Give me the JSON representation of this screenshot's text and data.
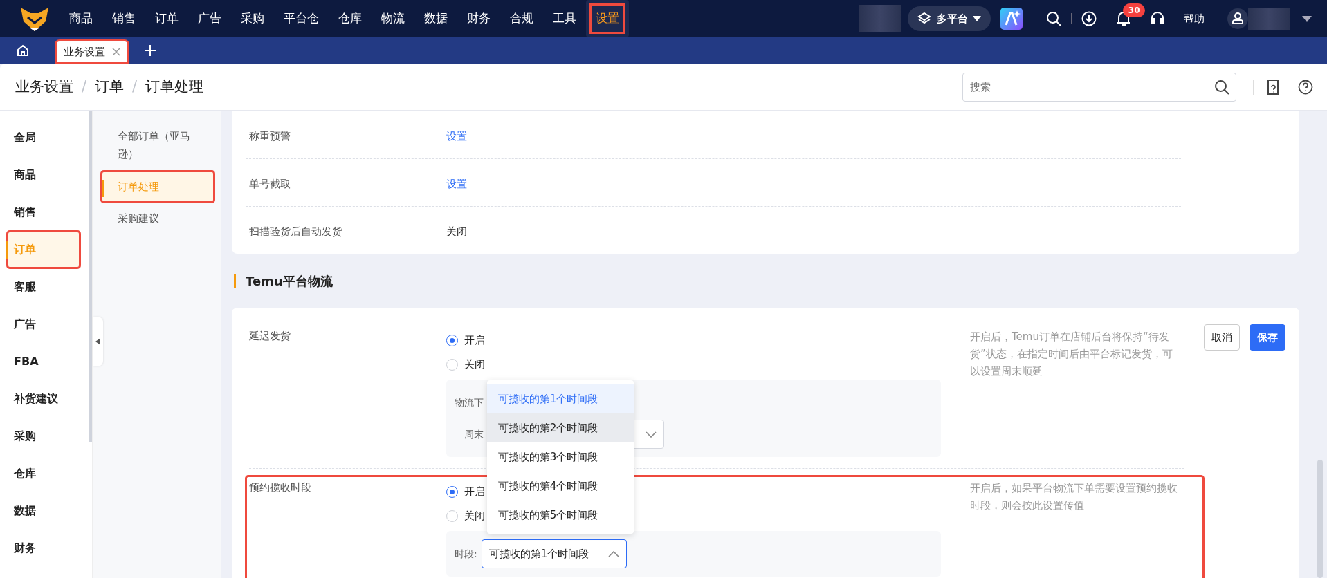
{
  "top_nav": {
    "items": [
      {
        "label": "商品",
        "selected": false,
        "highlighted": false
      },
      {
        "label": "销售",
        "selected": false,
        "highlighted": false
      },
      {
        "label": "订单",
        "selected": false,
        "highlighted": false
      },
      {
        "label": "广告",
        "selected": false,
        "highlighted": false
      },
      {
        "label": "采购",
        "selected": false,
        "highlighted": false
      },
      {
        "label": "平台仓",
        "selected": false,
        "highlighted": false
      },
      {
        "label": "仓库",
        "selected": false,
        "highlighted": false
      },
      {
        "label": "物流",
        "selected": false,
        "highlighted": false
      },
      {
        "label": "数据",
        "selected": false,
        "highlighted": false
      },
      {
        "label": "财务",
        "selected": false,
        "highlighted": false
      },
      {
        "label": "合规",
        "selected": false,
        "highlighted": false
      },
      {
        "label": "工具",
        "selected": false,
        "highlighted": false
      },
      {
        "label": "设置",
        "selected": true,
        "highlighted": true
      }
    ],
    "platform_switch": {
      "label": "多平台",
      "expanded": false
    },
    "notification_count": "30",
    "help": "帮助"
  },
  "tabs": [
    {
      "label": "业务设置",
      "selected": true,
      "highlighted": true
    }
  ],
  "breadcrumb": [
    "业务设置",
    "订单",
    "订单处理"
  ],
  "breadcrumb_separators": [
    "/",
    "/"
  ],
  "search": {
    "placeholder": "搜索"
  },
  "sidebar": {
    "items": [
      {
        "label": "全局",
        "selected": false,
        "highlighted": false
      },
      {
        "label": "商品",
        "selected": false,
        "highlighted": false
      },
      {
        "label": "销售",
        "selected": false,
        "highlighted": false
      },
      {
        "label": "订单",
        "selected": true,
        "highlighted": true
      },
      {
        "label": "客服",
        "selected": false,
        "highlighted": false
      },
      {
        "label": "广告",
        "selected": false,
        "highlighted": false
      },
      {
        "label": "FBA",
        "selected": false,
        "highlighted": false
      },
      {
        "label": "补货建议",
        "selected": false,
        "highlighted": false
      },
      {
        "label": "采购",
        "selected": false,
        "highlighted": false
      },
      {
        "label": "仓库",
        "selected": false,
        "highlighted": false
      },
      {
        "label": "数据",
        "selected": false,
        "highlighted": false
      },
      {
        "label": "财务",
        "selected": false,
        "highlighted": false
      }
    ]
  },
  "subnav": {
    "items": [
      {
        "label": "全部订单（亚马逊）",
        "selected": false,
        "highlighted": false
      },
      {
        "label": "订单处理",
        "selected": true,
        "highlighted": true
      },
      {
        "label": "采购建议",
        "selected": false,
        "highlighted": false
      }
    ]
  },
  "settings_card": {
    "rows": [
      {
        "label": "称重预警",
        "kind": "link",
        "value": "设置"
      },
      {
        "label": "单号截取",
        "kind": "link",
        "value": "设置"
      },
      {
        "label": "扫描验货后自动发货",
        "kind": "text",
        "value": "关闭"
      }
    ]
  },
  "section_title": "Temu平台物流",
  "temu_card": {
    "rows": [
      {
        "label": "延迟发货",
        "highlighted": false,
        "options": [
          {
            "label": "开启",
            "selected": true
          },
          {
            "label": "关闭",
            "selected": false
          }
        ],
        "fields": [
          {
            "label": "物流下",
            "kind": "text"
          },
          {
            "label": "周末",
            "kind": "select",
            "open": false
          }
        ],
        "description": "开启后，Temu订单在店铺后台将保持“待发货”状态，在指定时间后由平台标记发货，可以设置周末顺延",
        "buttons": [
          {
            "label": "取消",
            "kind": "secondary"
          },
          {
            "label": "保存",
            "kind": "primary"
          }
        ]
      },
      {
        "label": "预约揽收时段",
        "highlighted": true,
        "options": [
          {
            "label": "开启",
            "selected": true
          },
          {
            "label": "关闭",
            "selected": false
          }
        ],
        "fields": [
          {
            "label": "时段:",
            "kind": "select",
            "value": "可揽收的第1个时间段",
            "open": true
          }
        ],
        "description": "开启后，如果平台物流下单需要设置预约揽收时段，则会按此设置传值"
      }
    ]
  },
  "dropdown": {
    "options": [
      {
        "label": "可揽收的第1个时间段",
        "selected": true,
        "hovered": false
      },
      {
        "label": "可揽收的第2个时间段",
        "selected": false,
        "hovered": true
      },
      {
        "label": "可揽收的第3个时间段",
        "selected": false,
        "hovered": false
      },
      {
        "label": "可揽收的第4个时间段",
        "selected": false,
        "hovered": false
      },
      {
        "label": "可揽收的第5个时间段",
        "selected": false,
        "hovered": false
      }
    ]
  }
}
